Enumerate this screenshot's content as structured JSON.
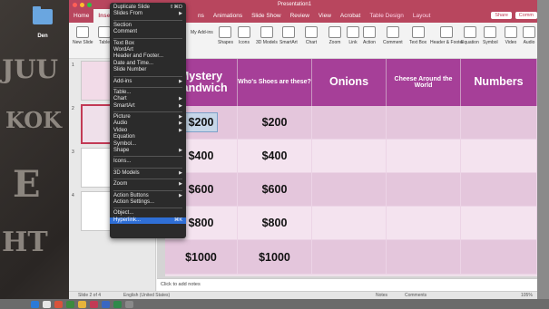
{
  "desktop": {
    "folder_label": "Den",
    "graffiti": [
      "JUU",
      "KOK",
      "E",
      "HT"
    ]
  },
  "window": {
    "title": "Presentation1"
  },
  "tabs": [
    "Home",
    "Insert",
    "Design",
    "Transitions",
    "Animations",
    "Slide Show",
    "Review",
    "View",
    "Acrobat",
    "Table Design",
    "Layout"
  ],
  "tabs_visible": {
    "home": "Home",
    "insert": "Insert",
    "transitions_tail": "ns",
    "animations": "Animations",
    "slideshow": "Slide Show",
    "review": "Review",
    "view": "View",
    "acrobat": "Acrobat",
    "table_design": "Table Design",
    "layout": "Layout"
  },
  "buttons": {
    "share": "Share",
    "comments": "Comm"
  },
  "ribbon": {
    "new_slide": "New Slide",
    "table": "Table",
    "addins_get": "Get Add-ins",
    "addins_my": "My Add-ins",
    "shapes": "Shapes",
    "icons": "Icons",
    "models": "3D Models",
    "smartart": "SmartArt",
    "chart": "Chart",
    "zoom": "Zoom",
    "link": "Link",
    "action": "Action",
    "comment": "Comment",
    "textbox": "Text Box",
    "header_footer": "Header & Footer",
    "wordart": "WordArt",
    "equation": "Equation",
    "symbol": "Symbol",
    "video": "Video",
    "audio": "Audio"
  },
  "menu": {
    "items": [
      {
        "label": "Duplicate Slide",
        "shortcut": "⇧⌘D"
      },
      {
        "label": "Slides From",
        "arrow": "▶"
      },
      {
        "sep": true
      },
      {
        "label": "Section"
      },
      {
        "label": "Comment"
      },
      {
        "sep": true
      },
      {
        "label": "Text Box"
      },
      {
        "label": "WordArt"
      },
      {
        "label": "Header and Footer..."
      },
      {
        "label": "Date and Time..."
      },
      {
        "label": "Slide Number"
      },
      {
        "sep": true
      },
      {
        "label": "Add-ins",
        "arrow": "▶"
      },
      {
        "sep": true
      },
      {
        "label": "Table..."
      },
      {
        "label": "Chart",
        "arrow": "▶"
      },
      {
        "label": "SmartArt",
        "arrow": "▶"
      },
      {
        "sep": true
      },
      {
        "label": "Picture",
        "arrow": "▶"
      },
      {
        "label": "Audio",
        "arrow": "▶"
      },
      {
        "label": "Video",
        "arrow": "▶"
      },
      {
        "label": "Equation"
      },
      {
        "label": "Symbol..."
      },
      {
        "label": "Shape",
        "arrow": "▶"
      },
      {
        "sep": true
      },
      {
        "label": "Icons..."
      },
      {
        "sep": true
      },
      {
        "label": "3D Models",
        "arrow": "▶"
      },
      {
        "sep": true
      },
      {
        "label": "Zoom",
        "arrow": "▶"
      },
      {
        "sep": true
      },
      {
        "label": "Action Buttons",
        "arrow": "▶"
      },
      {
        "label": "Action Settings..."
      },
      {
        "sep": true
      },
      {
        "label": "Object..."
      },
      {
        "label": "Hyperlink...",
        "shortcut": "⌘K",
        "highlight": true
      }
    ]
  },
  "thumbs": [
    "1",
    "2",
    "3",
    "4"
  ],
  "slide": {
    "headers": [
      "Mystery Sandwich",
      "Who's Shoes are these?",
      "Onions",
      "Cheese Around the World",
      "Numbers"
    ],
    "values": [
      "$200",
      "$400",
      "$600",
      "$800",
      "$1000"
    ]
  },
  "notes": "Click to add notes",
  "status": {
    "slide": "Slide 2 of 4",
    "lang": "English (United States)",
    "notes": "Notes",
    "comments": "Comments",
    "zoom": "105%"
  },
  "colors": {
    "accent": "#b8465e",
    "header": "#a63f98",
    "menu_bg": "#2b2b2b",
    "highlight": "#2f6fd6"
  }
}
